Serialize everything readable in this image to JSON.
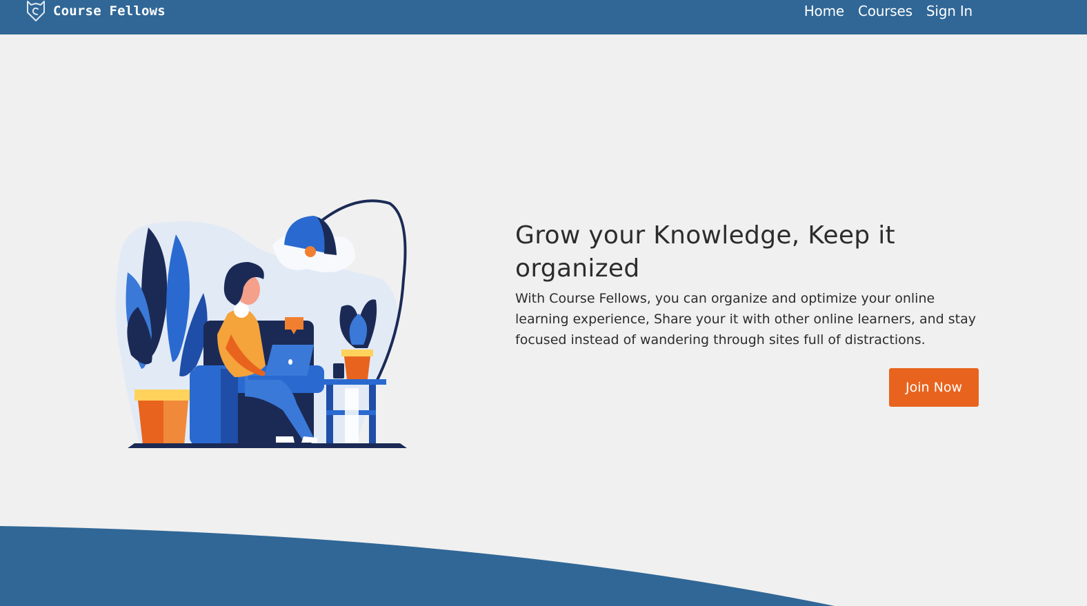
{
  "navbar": {
    "brand": "Course Fellows",
    "links": [
      {
        "label": "Home"
      },
      {
        "label": "Courses"
      },
      {
        "label": "Sign In"
      }
    ]
  },
  "hero": {
    "title": "Grow your Knowledge, Keep it organized",
    "description": "With Course Fellows, you can organize and optimize your online learning experience, Share your it with other online learners, and stay focused instead of wandering through sites full of distractions.",
    "cta_label": "Join Now"
  },
  "colors": {
    "navbar_bg": "#306796",
    "page_bg": "#f0f0f0",
    "accent": "#e8641e",
    "text": "#2c2c2c"
  },
  "icons": {
    "brand_logo": "fox-shield-logo-icon"
  }
}
